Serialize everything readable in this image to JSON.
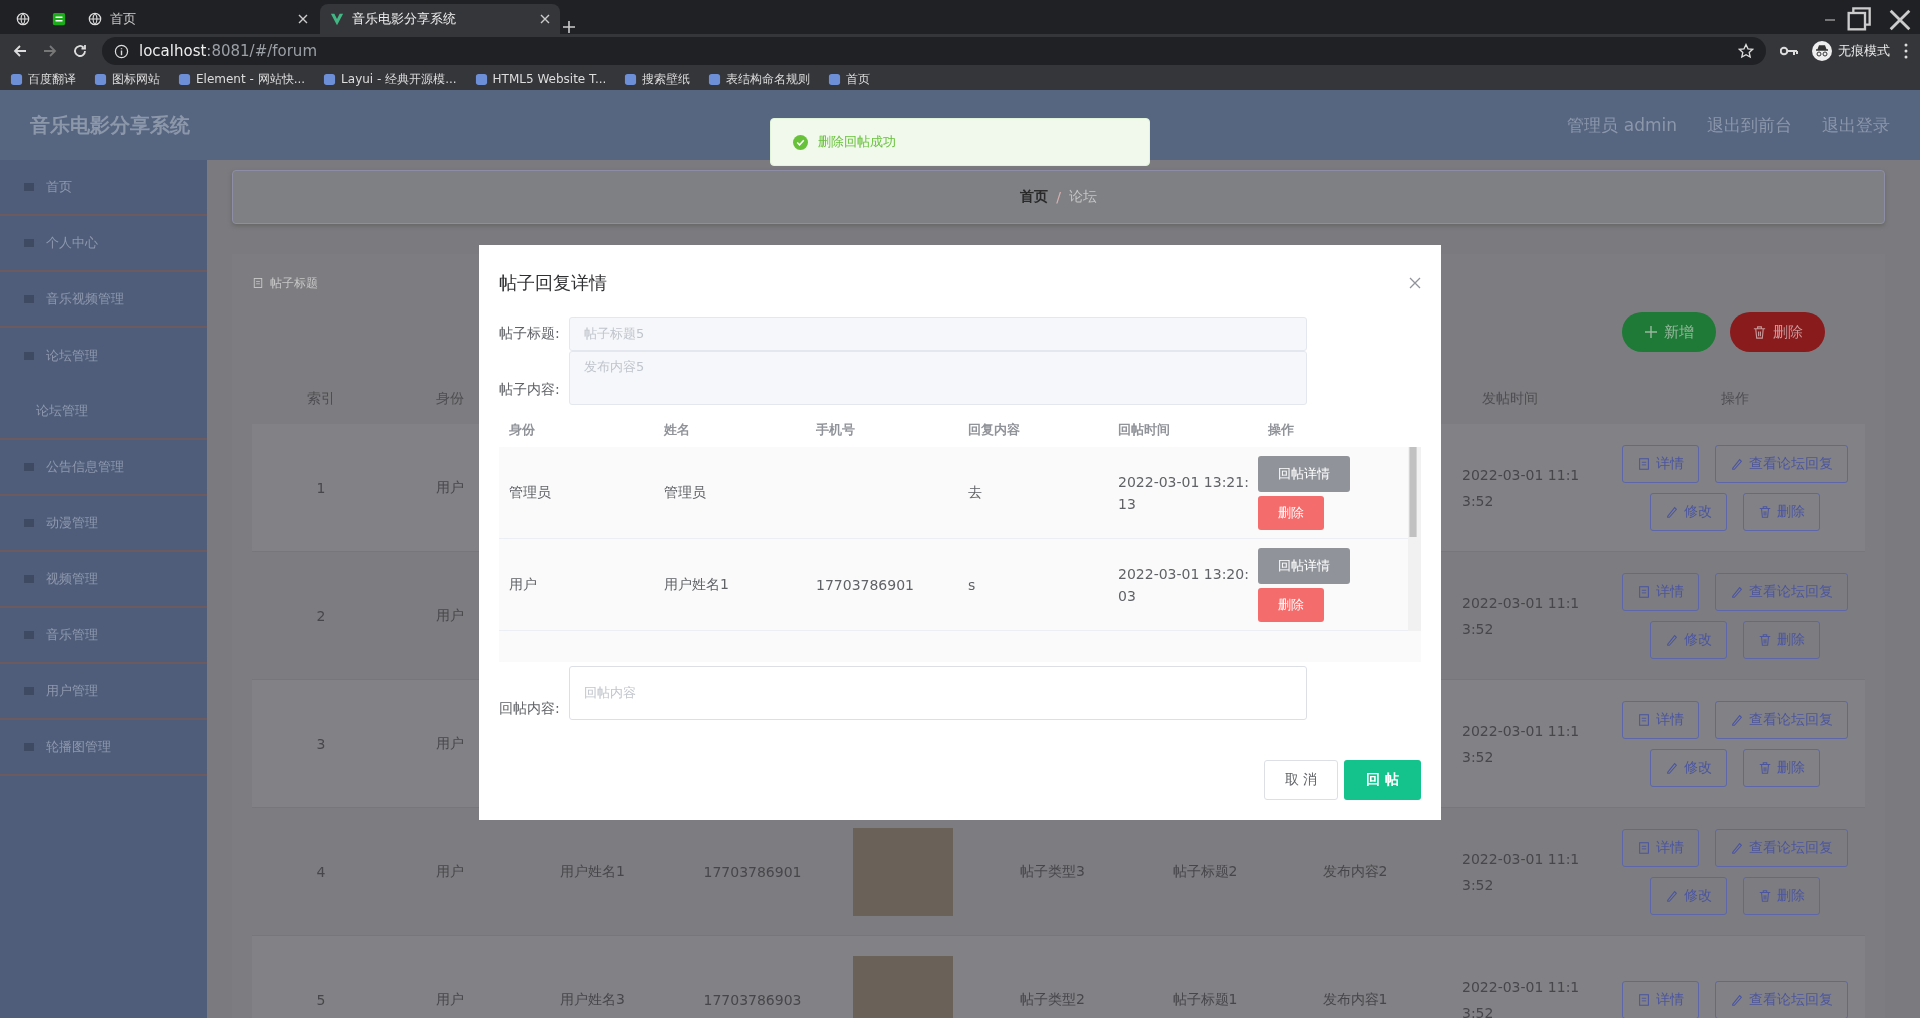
{
  "browser": {
    "tabs": [
      {
        "kind": "site",
        "selected": false
      },
      {
        "kind": "app",
        "selected": false
      },
      {
        "kind": "page",
        "title": "首页",
        "selected": false
      },
      {
        "kind": "page",
        "title": "音乐电影分享系统",
        "selected": true
      }
    ],
    "url": {
      "host": "localhost",
      "path": ":8081/#/forum"
    },
    "profile": "无痕模式",
    "bookmarks": [
      "百度翻译",
      "图标网站",
      "Element - 网站快...",
      "Layui - 经典开源模...",
      "HTML5 Website T...",
      "搜索壁纸",
      "表结构命名规则",
      "首页"
    ]
  },
  "header": {
    "title": "音乐电影分享系统",
    "links": [
      "管理员 admin",
      "退出到前台",
      "退出登录"
    ]
  },
  "sidebar": {
    "items": [
      {
        "label": "首页",
        "expanded": false
      },
      {
        "label": "个人中心",
        "expanded": false
      },
      {
        "label": "音乐视频管理",
        "expanded": false
      },
      {
        "label": "论坛管理",
        "expanded": true,
        "children": [
          {
            "label": "论坛管理"
          }
        ]
      },
      {
        "label": "公告信息管理",
        "expanded": false
      },
      {
        "label": "动漫管理",
        "expanded": false
      },
      {
        "label": "视频管理",
        "expanded": false
      },
      {
        "label": "音乐管理",
        "expanded": false
      },
      {
        "label": "用户管理",
        "expanded": false
      },
      {
        "label": "轮播图管理",
        "expanded": false
      }
    ]
  },
  "breadcrumb": {
    "items": [
      "首页",
      "论坛"
    ],
    "separator": "/"
  },
  "search": {
    "placeholder": "帖子标题"
  },
  "toolbar": {
    "add": "新增",
    "delete": "删除"
  },
  "table": {
    "columns": {
      "index": "索引",
      "role": "身份",
      "time": "发帖时间",
      "actions": "操作"
    },
    "rows": [
      {
        "index": "1",
        "role": "用户",
        "time": "2022-03-01 11:13:52",
        "actions": [
          "详情",
          "查看论坛回复",
          "修改",
          "删除"
        ]
      },
      {
        "index": "2",
        "role": "用户",
        "time": "2022-03-01 11:13:52",
        "actions": [
          "详情",
          "查看论坛回复",
          "修改",
          "删除"
        ]
      },
      {
        "index": "3",
        "role": "用户",
        "time": "2022-03-01 11:13:52",
        "actions": [
          "详情",
          "查看论坛回复",
          "修改",
          "删除"
        ]
      },
      {
        "index": "4",
        "role": "用户",
        "name": "用户姓名1",
        "phone": "17703786901",
        "photo": true,
        "type": "帖子类型3",
        "title": "帖子标题2",
        "content": "发布内容2",
        "time": "2022-03-01 11:13:52",
        "actions": [
          "详情",
          "查看论坛回复",
          "修改",
          "删除"
        ]
      },
      {
        "index": "5",
        "role": "用户",
        "name": "用户姓名3",
        "phone": "17703786903",
        "photo": true,
        "type": "帖子类型2",
        "title": "帖子标题1",
        "content": "发布内容1",
        "time": "2022-03-01 11:13:52",
        "actions": [
          "详情",
          "查看论坛回复"
        ]
      }
    ]
  },
  "toast": {
    "message": "删除回帖成功"
  },
  "dialog": {
    "title": "帖子回复详情",
    "fields": [
      {
        "label": "帖子标题:",
        "placeholder": "帖子标题5",
        "kind": "input"
      },
      {
        "label": "帖子内容:",
        "placeholder": "发布内容5",
        "kind": "textarea"
      }
    ],
    "columns": [
      "身份",
      "姓名",
      "手机号",
      "回复内容",
      "回帖时间",
      "操作"
    ],
    "rows": [
      {
        "role": "管理员",
        "name": "管理员",
        "content": "去",
        "time": "2022-03-01 13:21:13",
        "detail": "回帖详情",
        "delete": "删除"
      },
      {
        "role": "用户",
        "name": "用户姓名1",
        "phone": "17703786901",
        "content": "s",
        "time": "2022-03-01 13:20:03",
        "detail": "回帖详情",
        "delete": "删除"
      }
    ],
    "reply": {
      "label": "回帖内容:",
      "placeholder": "回帖内容"
    },
    "cancel": "取 消",
    "submit": "回 帖"
  }
}
